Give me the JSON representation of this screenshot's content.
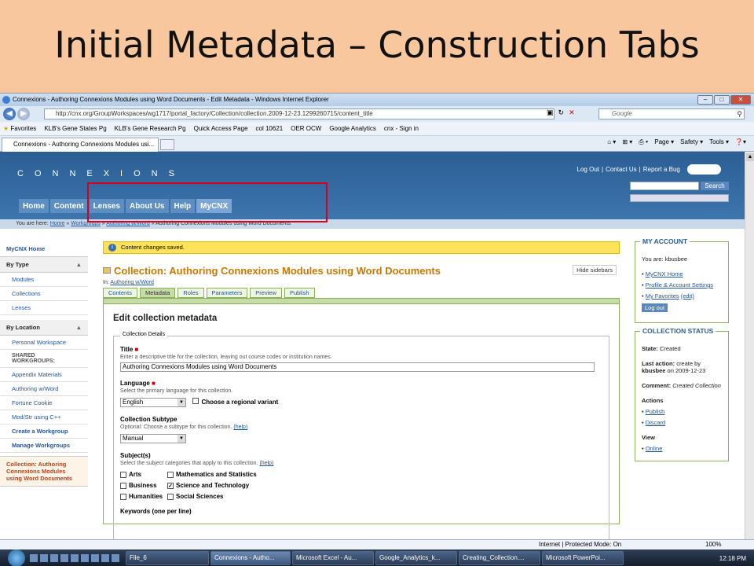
{
  "slide_title": "Initial Metadata – Construction Tabs",
  "browser": {
    "window_title": "Connexions - Authoring Connexions Modules using Word Documents - Edit Metadata - Windows Internet Explorer",
    "url": "http://cnx.org/GroupWorkspaces/wg1717/portal_factory/Collection/collection.2009-12-23.1299260715/content_title",
    "search_placeholder": "Google",
    "favorites_label": "Favorites",
    "favorites": [
      "KLB's Gene States Pg",
      "KLB's Gene Research Pg",
      "Quick Access Page",
      "col 10621",
      "OER OCW",
      "Google Analytics",
      "cnx - Sign in"
    ],
    "tab_label": "Connexions - Authoring Connexions Modules usi...",
    "commands": [
      "Page ▾",
      "Safety ▾",
      "Tools ▾"
    ],
    "status_zone": "Internet | Protected Mode: On",
    "zoom": "100%"
  },
  "site": {
    "logo": "CONNEXIONS",
    "top_links": [
      "Log Out",
      "Contact Us",
      "Report a Bug"
    ],
    "donate": "Donate",
    "search_button": "Search",
    "nav": [
      "Home",
      "Content",
      "Lenses",
      "About Us",
      "Help",
      "MyCNX"
    ],
    "breadcrumb_prefix": "You are here:",
    "breadcrumb": [
      "Home",
      "Workgroups",
      "Authoring w/Word",
      "Authoring Connexions Modules using Word Documents"
    ]
  },
  "left_sidebar": {
    "top": "MyCNX Home",
    "by_type": "By Type",
    "type_items": [
      "Modules",
      "Collections",
      "Lenses"
    ],
    "by_location": "By Location",
    "personal": "Personal Workspace",
    "shared_label": "SHARED WORKGROUPS:",
    "workgroups": [
      "Appendix Materials",
      "Authoring w/Word",
      "Fortune Cookie",
      "Mod/Str using C++"
    ],
    "create": "Create a Workgroup",
    "manage": "Manage Workgroups",
    "current": "Collection: Authoring Connexions Modules using Word Documents"
  },
  "main": {
    "notice": "Content changes saved.",
    "collection_title": "Collection: Authoring Connexions Modules using Word Documents",
    "hide_sidebars": "Hide sidebars",
    "in_label": "In:",
    "in_link": "Authoring w/Word",
    "tabs": [
      "Contents",
      "Metadata",
      "Roles",
      "Parameters",
      "Preview",
      "Publish"
    ],
    "heading": "Edit collection metadata",
    "legend": "Collection Details",
    "title_label": "Title",
    "title_help": "Enter a descriptive title for the collection, leaving out course codes or institution names.",
    "title_value": "Authoring Connexions Modules using Word Documents",
    "language_label": "Language",
    "language_help": "Select the primary language for this collection.",
    "language_value": "English",
    "variant_label": "Choose a regional variant",
    "subtype_label": "Collection Subtype",
    "subtype_help": "Optional: Choose a subtype for this collection.",
    "help_link": "(help)",
    "subtype_value": "Manual",
    "subjects_label": "Subject(s)",
    "subjects_help": "Select the subject categories that apply to this collection.",
    "subjects": [
      {
        "name": "Arts",
        "checked": false
      },
      {
        "name": "Mathematics and Statistics",
        "checked": false
      },
      {
        "name": "Business",
        "checked": false
      },
      {
        "name": "Science and Technology",
        "checked": true
      },
      {
        "name": "Humanities",
        "checked": false
      },
      {
        "name": "Social Sciences",
        "checked": false
      }
    ],
    "keywords_label": "Keywords (one per line)"
  },
  "right_sidebar": {
    "account_title": "MY ACCOUNT",
    "you_are": "You are: kbusbee",
    "links": [
      "MyCNX Home",
      "Profile & Account Settings",
      "My Favorites"
    ],
    "favorites_edit": "(edit)",
    "logout": "Log out",
    "status_title": "COLLECTION STATUS",
    "state_label": "State:",
    "state_value": "Created",
    "last_action_label": "Last action:",
    "last_action_value": "create by",
    "last_action_user": "kbusbee",
    "last_action_date": "on 2009-12-23",
    "comment_label": "Comment:",
    "comment_value": "Created Collection",
    "actions_label": "Actions",
    "actions": [
      "Publish",
      "Discard"
    ],
    "view_label": "View",
    "view_links": [
      "Online"
    ]
  },
  "taskbar": {
    "buttons": [
      "File_6",
      "Connexions - Autho...",
      "Microsoft Excel - Au...",
      "Google_Analytics_k...",
      "Creating_Collection....",
      "Microsoft PowerPoi..."
    ],
    "clock": "12:18 PM"
  }
}
